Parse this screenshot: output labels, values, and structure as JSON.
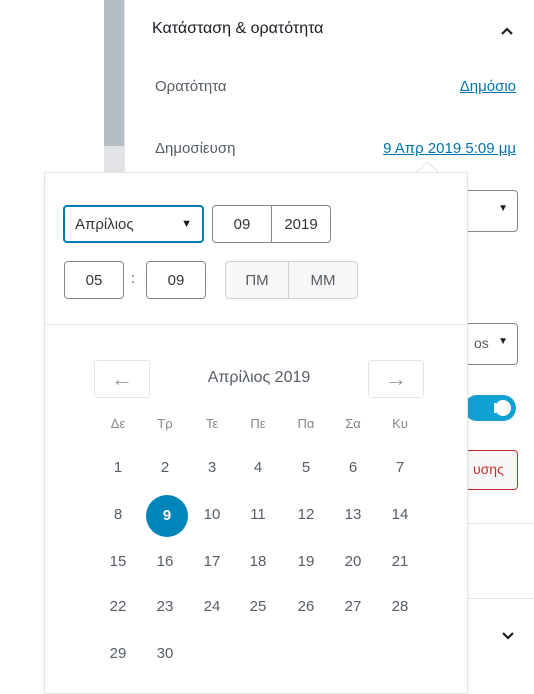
{
  "panel": {
    "title": "Κατάσταση & ορατότητα",
    "visibility_label": "Ορατότητα",
    "visibility_value": "Δημόσιο",
    "publish_label": "Δημοσίευση",
    "publish_value": "9 Απρ 2019 5:09 μμ"
  },
  "background": {
    "select_text": "os",
    "button_text": "υσης"
  },
  "datetime": {
    "month_options_selected": "Απρίλιος",
    "day": "09",
    "year": "2019",
    "hour": "05",
    "minute": "09",
    "colon": ":",
    "am_label": "ΠΜ",
    "pm_label": "ΜΜ"
  },
  "calendar": {
    "month_label": "Απρίλιος 2019",
    "prev_label": "←",
    "next_label": "→",
    "weekdays": [
      "Δε",
      "Τρ",
      "Τε",
      "Πε",
      "Πα",
      "Σα",
      "Κυ"
    ],
    "weeks": [
      [
        "1",
        "2",
        "3",
        "4",
        "5",
        "6",
        "7"
      ],
      [
        "8",
        "9",
        "10",
        "11",
        "12",
        "13",
        "14"
      ],
      [
        "15",
        "16",
        "17",
        "18",
        "19",
        "20",
        "21"
      ],
      [
        "22",
        "23",
        "24",
        "25",
        "26",
        "27",
        "28"
      ],
      [
        "29",
        "30"
      ]
    ],
    "selected_day": "9"
  },
  "colors": {
    "accent": "#0085ba",
    "link": "#0073aa",
    "danger": "#c92c2c",
    "toggle": "#11a0d2"
  }
}
